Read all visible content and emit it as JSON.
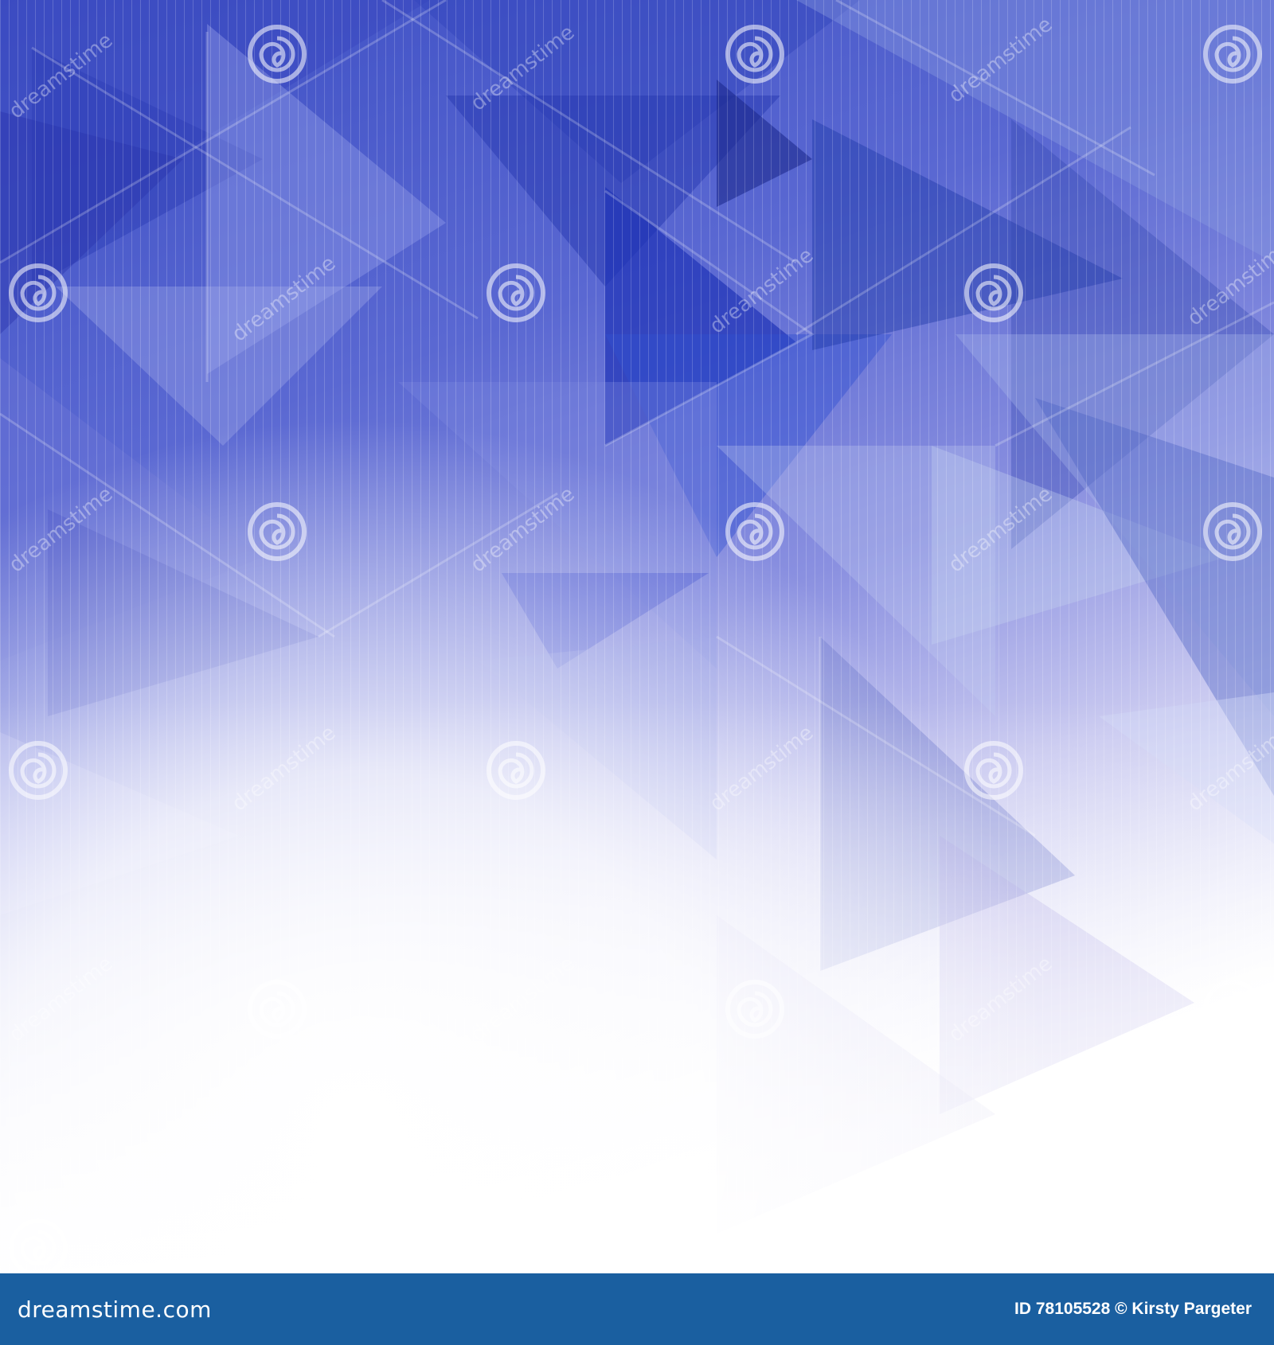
{
  "image": {
    "description_colors": {
      "deep": "#2d3fb8",
      "mid": "#5c6fd6",
      "light": "#9aa4e6",
      "fade": "#ffffff",
      "footer": "#1a5fa0"
    },
    "watermark": {
      "text": "dreamstime",
      "icon": "spiral-icon"
    }
  },
  "footer": {
    "brand": "dreamstime.com",
    "info": "ID 78105528 © Kirsty Pargeter"
  }
}
